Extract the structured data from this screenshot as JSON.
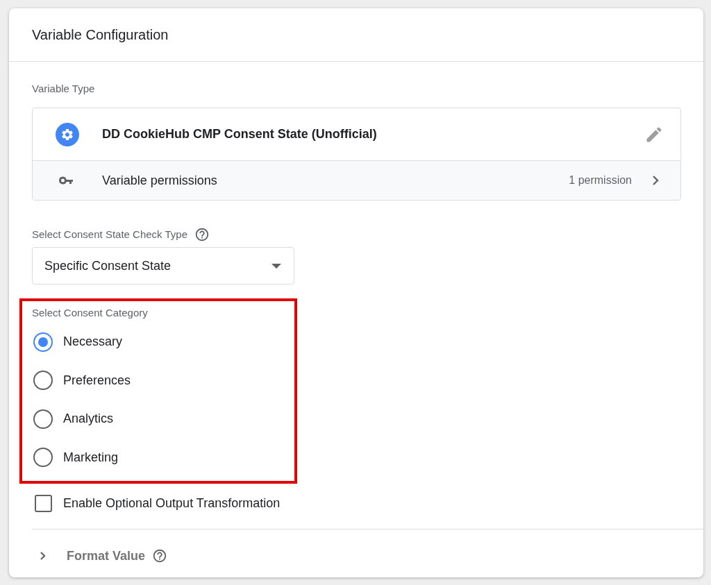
{
  "dialog": {
    "title": "Variable Configuration"
  },
  "variable_type": {
    "label": "Variable Type",
    "name": "DD CookieHub CMP Consent State (Unofficial)",
    "permissions_label": "Variable permissions",
    "permissions_count": "1 permission"
  },
  "check_type": {
    "label": "Select Consent State Check Type",
    "value": "Specific Consent State"
  },
  "consent_category": {
    "label": "Select Consent Category",
    "highlighted": true,
    "options": [
      {
        "label": "Necessary",
        "selected": true
      },
      {
        "label": "Preferences",
        "selected": false
      },
      {
        "label": "Analytics",
        "selected": false
      },
      {
        "label": "Marketing",
        "selected": false
      }
    ]
  },
  "output_transformation": {
    "label": "Enable Optional Output Transformation",
    "checked": false
  },
  "format_value": {
    "label": "Format Value",
    "expanded": false
  }
}
